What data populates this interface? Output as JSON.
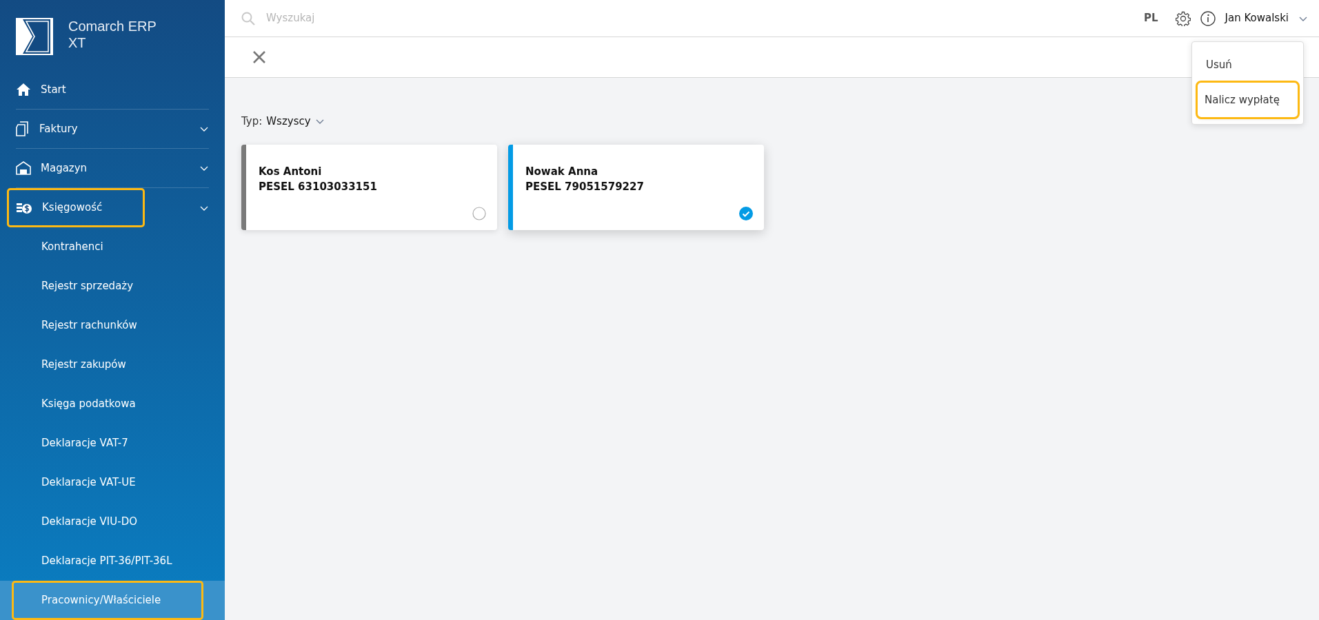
{
  "brand": {
    "name": "Comarch ERP XT"
  },
  "topbar": {
    "search_placeholder": "Wyszukaj",
    "language": "PL",
    "user": "Jan Kowalski"
  },
  "sidebar": {
    "items": [
      {
        "label": "Start",
        "expandable": false,
        "highlighted": false
      },
      {
        "label": "Faktury",
        "expandable": true,
        "highlighted": false
      },
      {
        "label": "Magazyn",
        "expandable": true,
        "highlighted": false
      },
      {
        "label": "Księgowość",
        "expandable": true,
        "highlighted": true,
        "children": [
          {
            "label": "Kontrahenci",
            "selected": false,
            "highlighted": false
          },
          {
            "label": "Rejestr sprzedaży",
            "selected": false,
            "highlighted": false
          },
          {
            "label": "Rejestr rachunków",
            "selected": false,
            "highlighted": false
          },
          {
            "label": "Rejestr zakupów",
            "selected": false,
            "highlighted": false
          },
          {
            "label": "Księga podatkowa",
            "selected": false,
            "highlighted": false
          },
          {
            "label": "Deklaracje VAT-7",
            "selected": false,
            "highlighted": false
          },
          {
            "label": "Deklaracje VAT-UE",
            "selected": false,
            "highlighted": false
          },
          {
            "label": "Deklaracje VIU-DO",
            "selected": false,
            "highlighted": false
          },
          {
            "label": "Deklaracje PIT-36/PIT-36L",
            "selected": false,
            "highlighted": false
          },
          {
            "label": "Pracownicy/Właściciele",
            "selected": true,
            "highlighted": true
          }
        ]
      }
    ]
  },
  "filter": {
    "label": "Typ:",
    "value": "Wszyscy"
  },
  "cards": [
    {
      "name": "Kos Antoni",
      "id_text": "PESEL 63103033151",
      "selected": false
    },
    {
      "name": "Nowak Anna",
      "id_text": "PESEL 79051579227",
      "selected": true
    }
  ],
  "menu": {
    "items": [
      {
        "label": "Usuń",
        "highlighted": false
      },
      {
        "label": "Nalicz wypłatę",
        "highlighted": true
      }
    ]
  }
}
